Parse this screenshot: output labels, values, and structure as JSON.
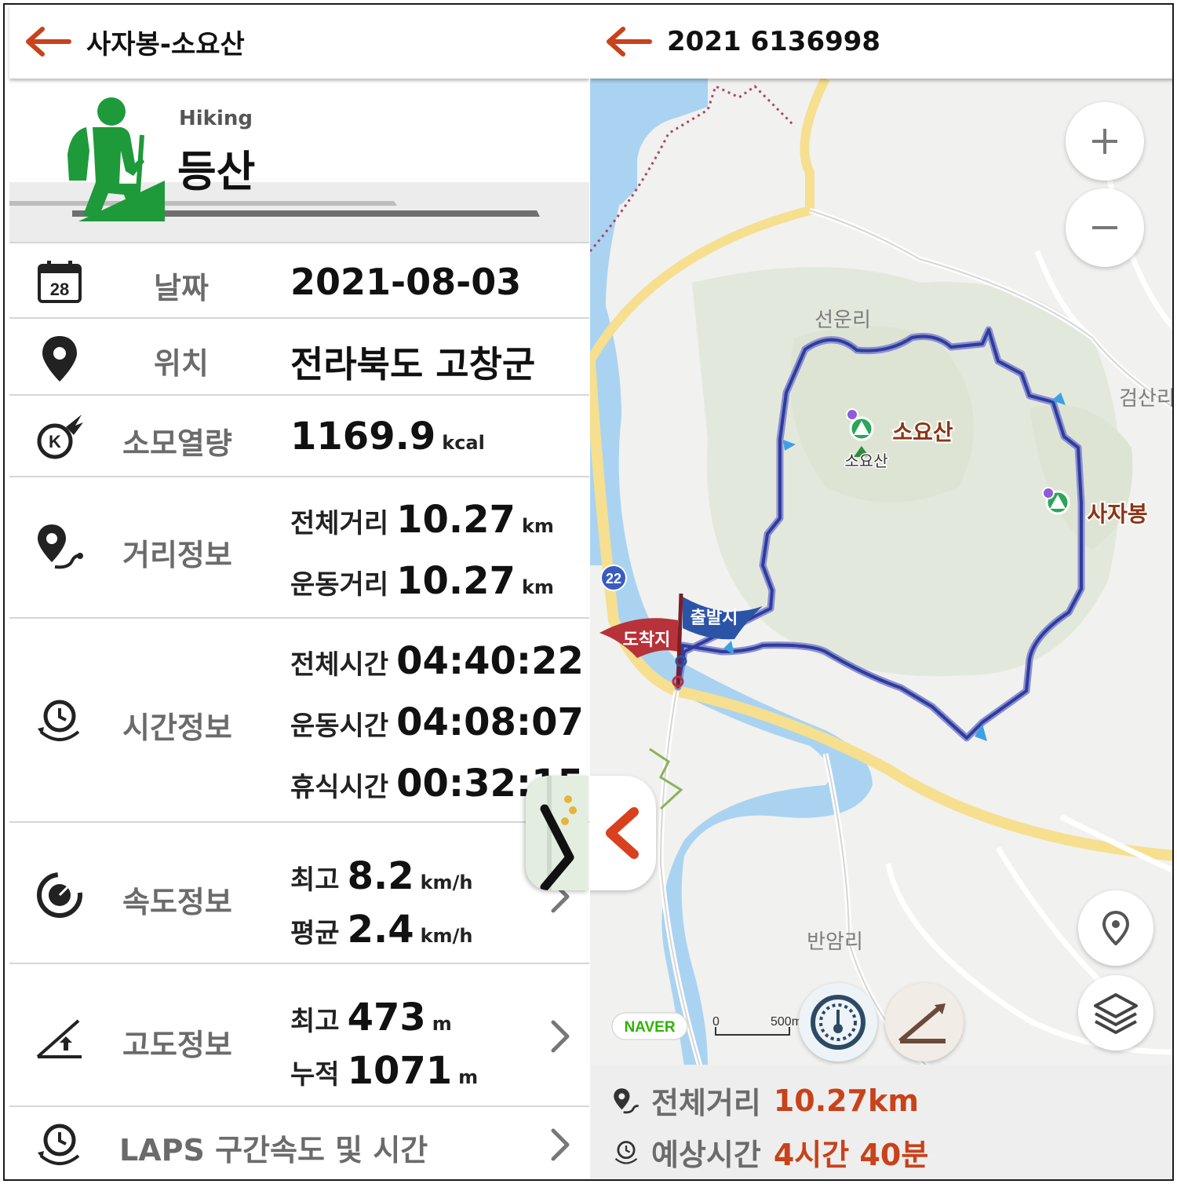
{
  "left": {
    "header": {
      "title": "사자봉-소요산"
    },
    "activity": {
      "category_en": "Hiking",
      "category_ko": "등산"
    },
    "date": {
      "label": "날짜",
      "value": "2021-08-03",
      "calendar_day": "28"
    },
    "location": {
      "label": "위치",
      "value": "전라북도 고창군"
    },
    "calories": {
      "label": "소모열량",
      "value": "1169.9",
      "unit": "kcal"
    },
    "distance": {
      "label": "거리정보",
      "total_label": "전체거리",
      "total_value": "10.27",
      "total_unit": "km",
      "moving_label": "운동거리",
      "moving_value": "10.27",
      "moving_unit": "km"
    },
    "time": {
      "label": "시간정보",
      "total_label": "전체시간",
      "total_value": "04:40:22",
      "moving_label": "운동시간",
      "moving_value": "04:08:07",
      "rest_label": "휴식시간",
      "rest_value": "00:32:15"
    },
    "speed": {
      "label": "속도정보",
      "max_label": "최고",
      "max_value": "8.2",
      "max_unit": "km/h",
      "avg_label": "평균",
      "avg_value": "2.4",
      "avg_unit": "km/h"
    },
    "altitude": {
      "label": "고도정보",
      "max_label": "최고",
      "max_value": "473",
      "max_unit": "m",
      "cum_label": "누적",
      "cum_value": "1071",
      "cum_unit": "m"
    },
    "laps": {
      "label": "LAPS 구간속도 및 시간"
    }
  },
  "right": {
    "header": {
      "title": "2021 6136998"
    },
    "map": {
      "places": {
        "seonun": "선운리",
        "geomsan": "검산리",
        "banam": "반암리",
        "soyosan_peak": "소요산",
        "soyosan_label": "소요산",
        "sajabong_label": "사자봉"
      },
      "route_number": "22",
      "start_flag": "출발지",
      "end_flag": "도착지",
      "provider": "NAVER",
      "scale_zero": "0",
      "scale_label": "500m"
    },
    "summary": {
      "distance_label": "전체거리",
      "distance_value": "10.27km",
      "time_label": "예상시간",
      "time_value": "4시간 40분"
    }
  },
  "colors": {
    "accent": "#c8421a",
    "hiker_green": "#1e9a3b",
    "route_blue": "#2c3e9b",
    "river": "#aad3f2",
    "road_yellow": "#f6df8f"
  },
  "icons": [
    "back-arrow-icon",
    "hiker-icon",
    "calendar-icon",
    "location-pin-icon",
    "calorie-icon",
    "distance-icon",
    "time-icon",
    "speed-icon",
    "altitude-icon",
    "laps-icon",
    "chevron-right-icon",
    "zoom-in-icon",
    "zoom-out-icon",
    "my-location-icon",
    "layers-icon",
    "speedometer-icon",
    "elevation-icon"
  ]
}
